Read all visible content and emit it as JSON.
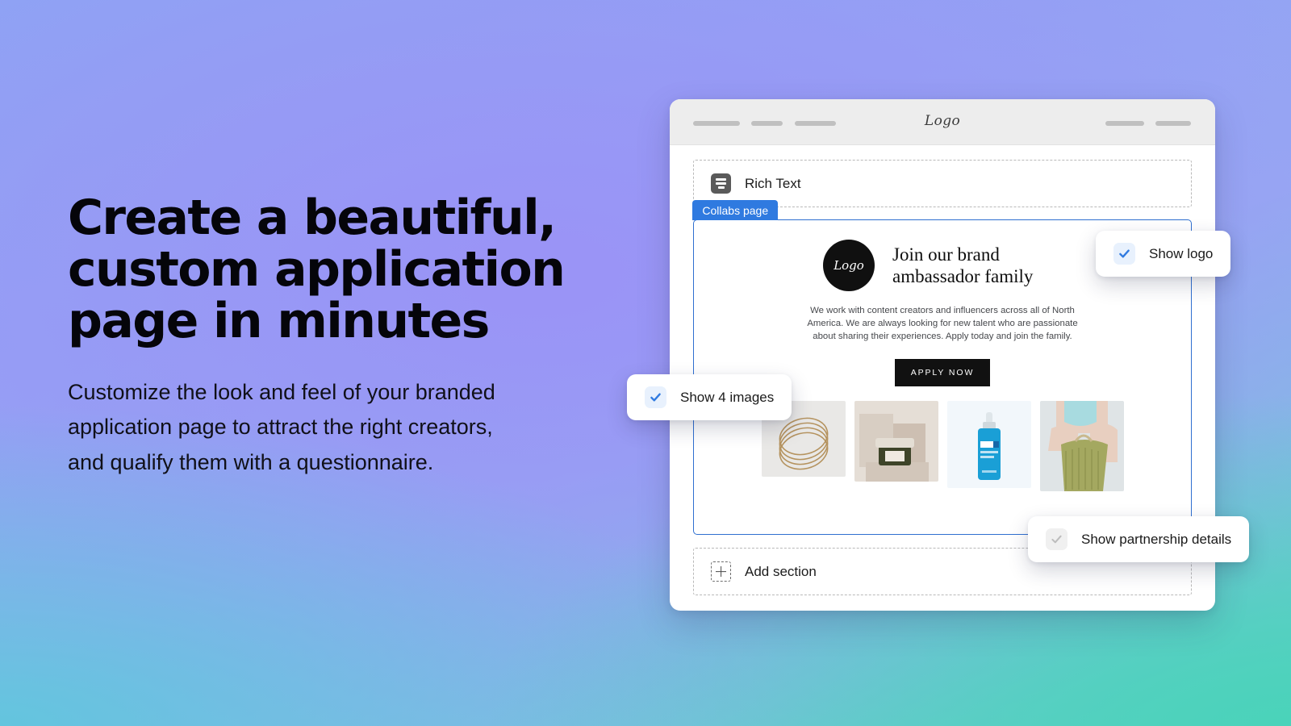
{
  "hero": {
    "headline": "Create a beautiful, custom application page in minutes",
    "subcopy": "Customize the look and feel of your branded application page to attract the right creators, and qualify them with a questionnaire."
  },
  "browser": {
    "brandmark": "Logo",
    "topbar_pills": 5
  },
  "editor": {
    "rich_text_block": {
      "label": "Rich Text",
      "icon": "rich-text-icon"
    },
    "collabs_panel": {
      "tag": "Collabs page",
      "logo_text": "Logo",
      "title": "Join our brand ambassador family",
      "body": "We work with content creators and influencers across all of North America. We are always looking for new talent who are passionate about sharing their experiences. Apply today and join the family.",
      "cta_label": "APPLY NOW",
      "images": [
        {
          "alt": "gold bangle bracelets"
        },
        {
          "alt": "cosmetic cream jar on blocks"
        },
        {
          "alt": "blue serum dropper bottle"
        },
        {
          "alt": "green fringed handbag"
        }
      ]
    },
    "add_section": {
      "label": "Add section",
      "icon": "add-section-icon"
    }
  },
  "toggles": [
    {
      "label": "Show logo",
      "checked": true
    },
    {
      "label": "Show 4 images",
      "checked": true
    },
    {
      "label": "Show partnership details",
      "checked": false
    }
  ],
  "colors": {
    "accent_blue": "#2f7ae0",
    "panel_border": "#2f6fd0",
    "check_on": "#2f7ae0",
    "check_off": "#bdbdbd",
    "cta_bg": "#111111",
    "gradient_top_left": "#8ca6f3",
    "gradient_mid": "#9a93f6",
    "gradient_bottom_left": "#63c5de",
    "gradient_bottom_right": "#4ad3ba"
  }
}
